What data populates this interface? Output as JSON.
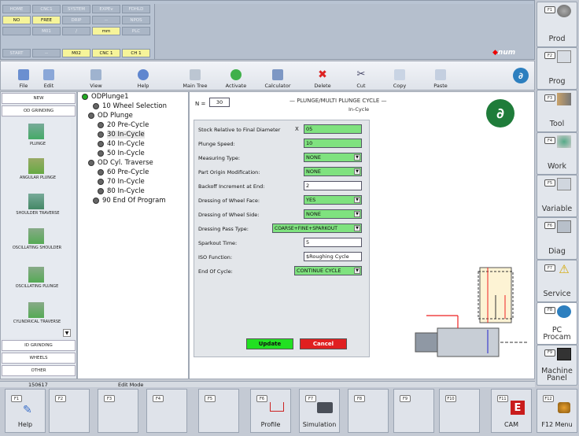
{
  "status": {
    "row1": [
      "HOME",
      "CNC1",
      "SYSTEM",
      "EXPEv",
      "FDHLD"
    ],
    "row2": [
      "NO",
      "FREE",
      "DRIP",
      "--",
      "NPOS"
    ],
    "row3": [
      "",
      "M01",
      "/",
      "mm",
      "PLC"
    ],
    "row4": [
      "START",
      "--",
      "M02",
      "CNC 1",
      "CH 1"
    ],
    "logo": "num"
  },
  "toolbar": {
    "file": "File",
    "edit": "Edit",
    "view": "View",
    "help": "Help",
    "main_tree": "Main Tree",
    "activate": "Activate",
    "calculator": "Calculator",
    "delete": "Delete",
    "cut": "Cut",
    "copy": "Copy",
    "paste": "Paste"
  },
  "left_nav": {
    "new": "NEW",
    "od_grinding": "OD GRINDING",
    "items": [
      "PLUNGE",
      "ANGULAR PLUNGE",
      "SHOULDER TRAVERSE",
      "OSCILLATING SHOULDER",
      "OSCILLATING PLUNGE",
      "CYLINDRICAL TRAVERSE"
    ],
    "id_grinding": "ID GRINDING",
    "wheels": "WHEELS",
    "other": "OTHER"
  },
  "tree": {
    "root": "ODPlunge1",
    "items": [
      "10 Wheel Selection",
      "OD Plunge",
      "20 Pre-Cycle",
      "30 In-Cycle",
      "40 In-Cycle",
      "50 In-Cycle",
      "OD Cyl. Traverse",
      "60 Pre-Cycle",
      "70 In-Cycle",
      "80 In-Cycle",
      "90 End Of Program"
    ]
  },
  "form": {
    "n_label": "N =",
    "n_value": "30",
    "title": "— PLUNGE/MULTI PLUNGE CYCLE —",
    "subtitle": "In-Cycle",
    "fields": [
      {
        "label": "Stock Relative to Final Diameter",
        "prefix": "X",
        "value": "05"
      },
      {
        "label": "Plunge Speed:",
        "value": "10"
      },
      {
        "label": "Measuring Type:",
        "value": "NONE"
      },
      {
        "label": "Part Origin Modification:",
        "value": "NONE"
      },
      {
        "label": "Backoff Increment at End:",
        "value": "2"
      },
      {
        "label": "Dressing of Wheel Face:",
        "value": "YES"
      },
      {
        "label": "Dressing of Wheel Side:",
        "value": "NONE"
      },
      {
        "label": "Dressing Pass Type:",
        "value": "COARSE+FINE+SPARKOUT"
      },
      {
        "label": "Sparkout Time:",
        "value": "5"
      },
      {
        "label": "ISO Function:",
        "value": "$Roughing Cycle"
      },
      {
        "label": "End Of Cycle:",
        "value": "CONTINUE CYCLE"
      }
    ],
    "update": "Update",
    "cancel": "Cancel"
  },
  "statusbar": {
    "left": "150617",
    "mode": "Edit Mode"
  },
  "right_menu": [
    {
      "fk": "F1",
      "label": "Prod"
    },
    {
      "fk": "F2",
      "label": "Prog"
    },
    {
      "fk": "F3",
      "label": "Tool"
    },
    {
      "fk": "F4",
      "label": "Work"
    },
    {
      "fk": "F5",
      "label": "Variable"
    },
    {
      "fk": "F6",
      "label": "Diag"
    },
    {
      "fk": "F7",
      "label": "Service"
    },
    {
      "fk": "F8",
      "label": "PC Procam"
    },
    {
      "fk": "F9",
      "label": "Machine Panel"
    }
  ],
  "bottom_menu": [
    {
      "fk": "F1",
      "label": "Help"
    },
    {
      "fk": "F2",
      "label": ""
    },
    {
      "fk": "F3",
      "label": ""
    },
    {
      "fk": "F4",
      "label": ""
    },
    {
      "fk": "F5",
      "label": ""
    },
    {
      "fk": "F6",
      "label": "Profile"
    },
    {
      "fk": "F7",
      "label": "Simulation"
    },
    {
      "fk": "F8",
      "label": ""
    },
    {
      "fk": "F9",
      "label": ""
    },
    {
      "fk": "F10",
      "label": ""
    },
    {
      "fk": "F11",
      "label": "CAM"
    },
    {
      "fk": "F12",
      "label": "F12 Menu"
    }
  ]
}
